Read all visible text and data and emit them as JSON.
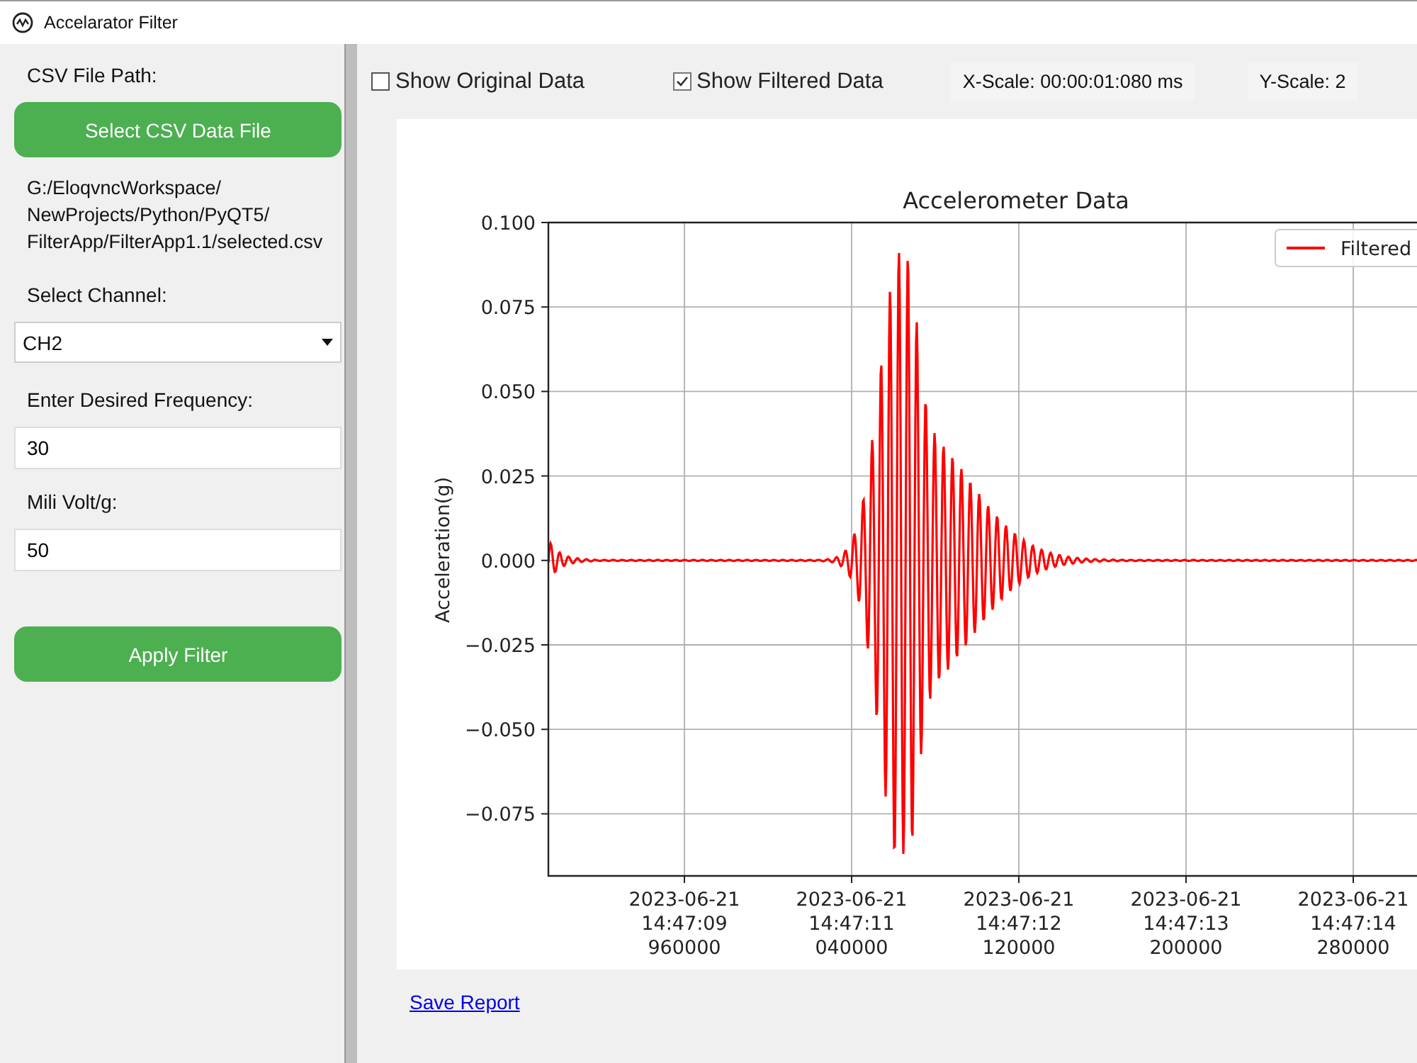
{
  "window": {
    "title": "Accelarator Filter"
  },
  "sidebar": {
    "path_label": "CSV File Path:",
    "select_button": "Select CSV Data File",
    "path_lines": [
      "G:/EloqvncWorkspace/",
      "NewProjects/Python/PyQT5/",
      "FilterApp/FilterApp1.1/selected.csv"
    ],
    "channel_label": "Select Channel:",
    "channel": {
      "value": "CH2"
    },
    "frequency_label": "Enter Desired Frequency:",
    "frequency": {
      "value": "30"
    },
    "mv_label": "Mili Volt/g:",
    "mv": {
      "value": "50"
    },
    "apply_button": "Apply Filter"
  },
  "toolbar": {
    "checkboxes": [
      {
        "label": "Show Original Data",
        "checked": false
      },
      {
        "label": "Show Filtered Data",
        "checked": true
      }
    ],
    "x_scale": "X-Scale: 00:00:01:080 ms",
    "y_scale": "Y-Scale: 2"
  },
  "plot": {
    "title": "Accelerometer Data",
    "ylabel": "Acceleration(g)",
    "yticks": [
      "0.100",
      "0.075",
      "0.050",
      "0.025",
      "0.000",
      "−0.025",
      "−0.050",
      "−0.075"
    ],
    "xticks": [
      [
        "2023-06-21",
        "14:47:09",
        "960000"
      ],
      [
        "2023-06-21",
        "14:47:11",
        "040000"
      ],
      [
        "2023-06-21",
        "14:47:12",
        "120000"
      ],
      [
        "2023-06-21",
        "14:47:13",
        "200000"
      ],
      [
        "2023-06-21",
        "14:47:14",
        "280000"
      ]
    ],
    "legend": {
      "label": "Filtered",
      "color": "#ff0000"
    }
  },
  "save_link": "Save Report"
}
